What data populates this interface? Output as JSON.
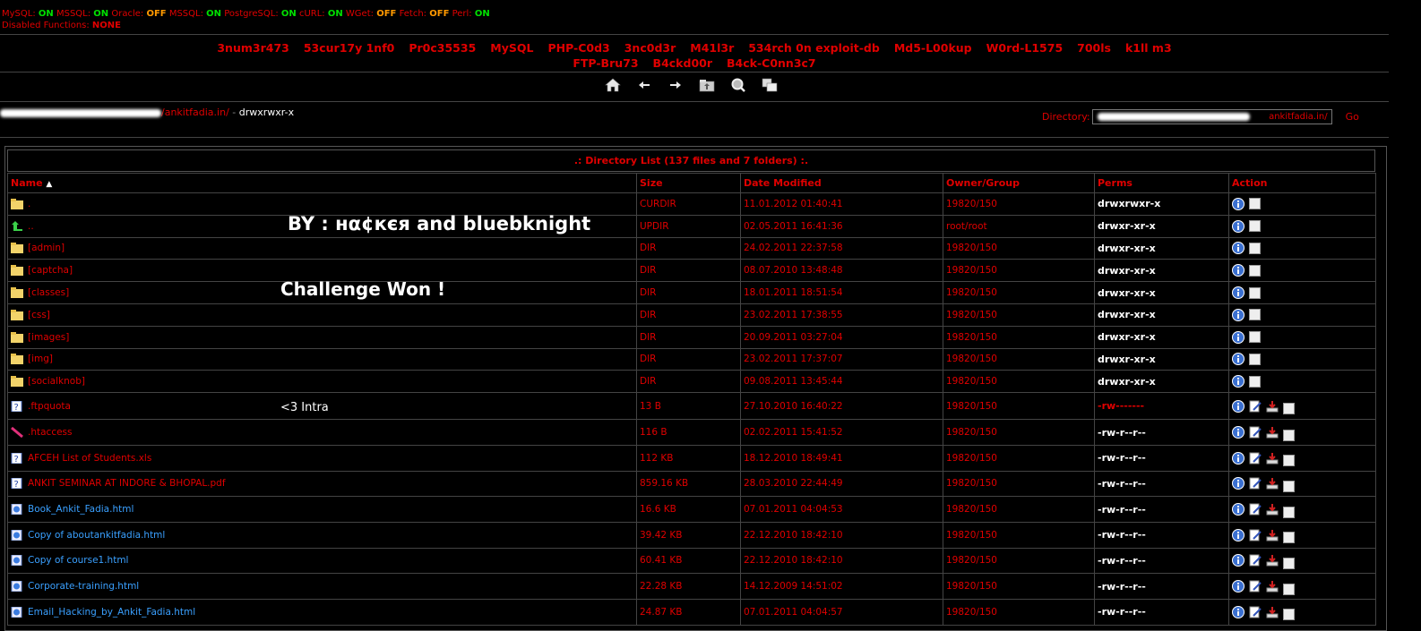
{
  "status": {
    "items": [
      {
        "label": "MySQL:",
        "value": "ON",
        "state": "on"
      },
      {
        "label": "MSSQL:",
        "value": "ON",
        "state": "on"
      },
      {
        "label": "Oracle:",
        "value": "OFF",
        "state": "off"
      },
      {
        "label": "MSSQL:",
        "value": "ON",
        "state": "on"
      },
      {
        "label": "PostgreSQL:",
        "value": "ON",
        "state": "on"
      },
      {
        "label": "cURL:",
        "value": "ON",
        "state": "on"
      },
      {
        "label": "WGet:",
        "value": "OFF",
        "state": "off"
      },
      {
        "label": "Fetch:",
        "value": "OFF",
        "state": "off"
      },
      {
        "label": "Perl:",
        "value": "ON",
        "state": "on"
      }
    ],
    "disabled_label": "Disabled Functions:",
    "disabled_value": "NONE"
  },
  "menu": {
    "row1": [
      "3num3r473",
      "53cur17y 1nf0",
      "Pr0c35535",
      "MySQL",
      "PHP-C0d3",
      "3nc0d3r",
      "M41l3r",
      "534rch 0n exploit-db",
      "Md5-L00kup",
      "W0rd-L1575",
      "700ls",
      "k1ll m3"
    ],
    "row2": [
      "FTP-Bru73",
      "B4ckd00r",
      "B4ck-C0nn3c7"
    ]
  },
  "toolbar": [
    "home-icon",
    "back-arrow-icon",
    "forward-arrow-icon",
    "folder-up-icon",
    "search-icon",
    "copy-icon"
  ],
  "path": {
    "link": "/ankitfadia.in/",
    "sep": "-",
    "perms": "drwxrwxr-x"
  },
  "directory": {
    "label": "Directory:",
    "value": "ankitfadia.in/",
    "go": "Go"
  },
  "list_title": ".: Directory List (137 files and 7 folders) :.",
  "columns": {
    "name": "Name",
    "sort": "▲",
    "size": "Size",
    "date": "Date Modified",
    "owner": "Owner/Group",
    "perms": "Perms",
    "action": "Action"
  },
  "rows": [
    {
      "icon": "folder",
      "name": ".",
      "size": "CURDIR",
      "date": "11.01.2012 01:40:41",
      "owner": "19820/150",
      "perms": "drwxrwxr-x",
      "kind": "dir"
    },
    {
      "icon": "up",
      "name": "..",
      "size": "UPDIR",
      "date": "02.05.2011 16:41:36",
      "owner": "root/root",
      "perms": "drwxr-xr-x",
      "kind": "dir"
    },
    {
      "icon": "folder",
      "name": "[admin]",
      "size": "DIR",
      "date": "24.02.2011 22:37:58",
      "owner": "19820/150",
      "perms": "drwxr-xr-x",
      "kind": "dir"
    },
    {
      "icon": "folder",
      "name": "[captcha]",
      "size": "DIR",
      "date": "08.07.2010 13:48:48",
      "owner": "19820/150",
      "perms": "drwxr-xr-x",
      "kind": "dir"
    },
    {
      "icon": "folder",
      "name": "[classes]",
      "size": "DIR",
      "date": "18.01.2011 18:51:54",
      "owner": "19820/150",
      "perms": "drwxr-xr-x",
      "kind": "dir"
    },
    {
      "icon": "folder",
      "name": "[css]",
      "size": "DIR",
      "date": "23.02.2011 17:38:55",
      "owner": "19820/150",
      "perms": "drwxr-xr-x",
      "kind": "dir"
    },
    {
      "icon": "folder",
      "name": "[images]",
      "size": "DIR",
      "date": "20.09.2011 03:27:04",
      "owner": "19820/150",
      "perms": "drwxr-xr-x",
      "kind": "dir"
    },
    {
      "icon": "folder",
      "name": "[img]",
      "size": "DIR",
      "date": "23.02.2011 17:37:07",
      "owner": "19820/150",
      "perms": "drwxr-xr-x",
      "kind": "dir"
    },
    {
      "icon": "folder",
      "name": "[socialknob]",
      "size": "DIR",
      "date": "09.08.2011 13:45:44",
      "owner": "19820/150",
      "perms": "drwxr-xr-x",
      "kind": "dir"
    },
    {
      "icon": "unknown",
      "name": ".ftpquota",
      "size": "13 B",
      "date": "27.10.2010 16:40:22",
      "owner": "19820/150",
      "perms": "-rw-------",
      "kind": "file",
      "permRed": true
    },
    {
      "icon": "feather",
      "name": ".htaccess",
      "size": "116 B",
      "date": "02.02.2011 15:41:52",
      "owner": "19820/150",
      "perms": "-rw-r--r--",
      "kind": "file"
    },
    {
      "icon": "unknown",
      "name": "AFCEH List of Students.xls",
      "size": "112 KB",
      "date": "18.12.2010 18:49:41",
      "owner": "19820/150",
      "perms": "-rw-r--r--",
      "kind": "file"
    },
    {
      "icon": "unknown",
      "name": "ANKIT SEMINAR AT INDORE & BHOPAL.pdf",
      "size": "859.16 KB",
      "date": "28.03.2010 22:44:49",
      "owner": "19820/150",
      "perms": "-rw-r--r--",
      "kind": "file"
    },
    {
      "icon": "html",
      "name": "Book_Ankit_Fadia.html",
      "size": "16.6 KB",
      "date": "07.01.2011 04:04:53",
      "owner": "19820/150",
      "perms": "-rw-r--r--",
      "kind": "file",
      "blue": true
    },
    {
      "icon": "html",
      "name": "Copy of aboutankitfadia.html",
      "size": "39.42 KB",
      "date": "22.12.2010 18:42:10",
      "owner": "19820/150",
      "perms": "-rw-r--r--",
      "kind": "file",
      "blue": true
    },
    {
      "icon": "html",
      "name": "Copy of course1.html",
      "size": "60.41 KB",
      "date": "22.12.2010 18:42:10",
      "owner": "19820/150",
      "perms": "-rw-r--r--",
      "kind": "file",
      "blue": true
    },
    {
      "icon": "html",
      "name": "Corporate-training.html",
      "size": "22.28 KB",
      "date": "14.12.2009 14:51:02",
      "owner": "19820/150",
      "perms": "-rw-r--r--",
      "kind": "file",
      "blue": true
    },
    {
      "icon": "html",
      "name": "Email_Hacking_by_Ankit_Fadia.html",
      "size": "24.87 KB",
      "date": "07.01.2011 04:04:57",
      "owner": "19820/150",
      "perms": "-rw-r--r--",
      "kind": "file",
      "blue": true
    }
  ],
  "overlay": {
    "line1": "BY : нα¢кєя and bluebknight",
    "line2": "Challenge Won !",
    "line3": "<3 Intra"
  },
  "colors": {
    "accent": "#e00000",
    "on": "#00e000",
    "off": "#ff9900",
    "link_blue": "#3aa0ff"
  }
}
